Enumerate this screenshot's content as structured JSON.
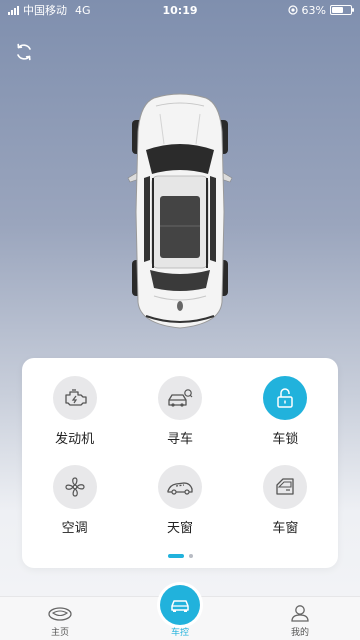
{
  "status_bar": {
    "carrier": "中国移动",
    "network": "4G",
    "time": "10:19",
    "battery": "63%",
    "battery_level": 0.63
  },
  "controls": [
    {
      "label": "发动机",
      "icon": "engine-icon",
      "active": false
    },
    {
      "label": "寻车",
      "icon": "find-car-icon",
      "active": false
    },
    {
      "label": "车锁",
      "icon": "unlock-icon",
      "active": true
    },
    {
      "label": "空调",
      "icon": "fan-icon",
      "active": false
    },
    {
      "label": "天窗",
      "icon": "sunroof-icon",
      "active": false
    },
    {
      "label": "车窗",
      "icon": "window-icon",
      "active": false
    }
  ],
  "pager": {
    "current": 1,
    "total": 2
  },
  "tabs": [
    {
      "label": "主页",
      "icon": "home-logo-icon",
      "active": false
    },
    {
      "label": "车控",
      "icon": "car-control-icon",
      "active": true
    },
    {
      "label": "我的",
      "icon": "profile-icon",
      "active": false
    }
  ],
  "colors": {
    "accent": "#21b2dc",
    "icon_bg": "#e8e8ea",
    "icon_stroke": "#555555"
  }
}
